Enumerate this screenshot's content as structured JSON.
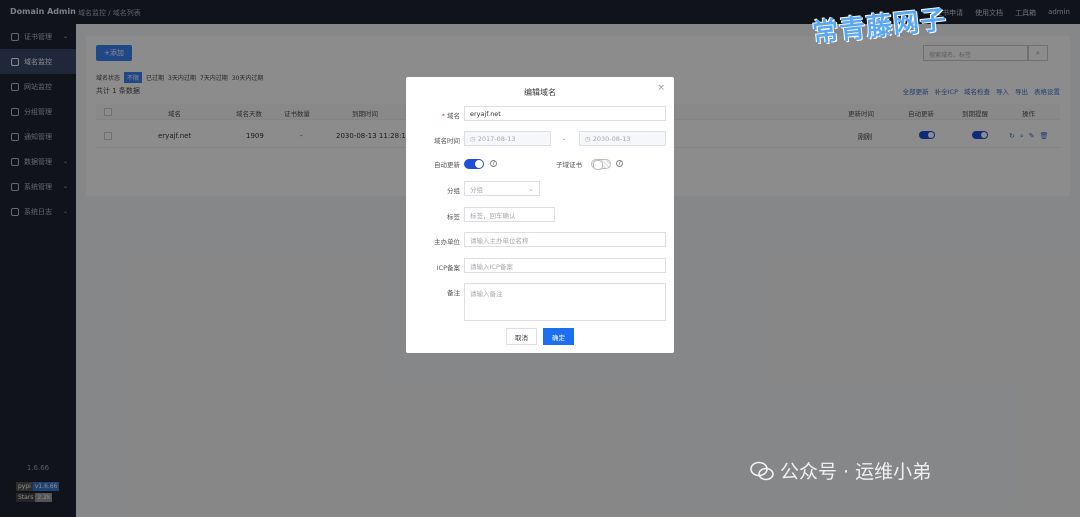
{
  "header": {
    "brand": "Domain Admin",
    "breadcrumb": "域名监控 / 域名列表",
    "links": [
      "证书申请",
      "使用文档",
      "工具箱",
      "admin"
    ]
  },
  "sidebar": {
    "items": [
      {
        "label": "证书管理",
        "icon": "certificate-icon",
        "has_children": true
      },
      {
        "label": "域名监控",
        "icon": "monitor-icon",
        "active": true
      },
      {
        "label": "网站监控",
        "icon": "website-icon"
      },
      {
        "label": "分组管理",
        "icon": "group-icon"
      },
      {
        "label": "通知管理",
        "icon": "notification-icon"
      },
      {
        "label": "数据管理",
        "icon": "data-icon",
        "has_children": true
      },
      {
        "label": "系统管理",
        "icon": "settings-icon",
        "has_children": true
      },
      {
        "label": "系统日志",
        "icon": "log-icon",
        "has_children": true
      }
    ],
    "version": "1.6.66",
    "badge_pypi_left": "pypi",
    "badge_pypi_right": "v1.6.66",
    "badge_stars_left": "Stars",
    "badge_stars_right": "2.2k"
  },
  "main": {
    "add_label": "+添加",
    "search_placeholder": "搜索域名、标签",
    "filter_label": "域名状态",
    "filters": [
      "不限",
      "已过期",
      "3天内过期",
      "7天内过期",
      "30天内过期"
    ],
    "total": "共计 1 条数据",
    "toolbar": [
      "全部更新",
      "补全ICP",
      "域名检查",
      "导入",
      "导出",
      "表格设置"
    ],
    "columns": [
      "域名",
      "域名天数",
      "证书数量",
      "到期时间",
      "更新时间",
      "自动更新",
      "到期提醒",
      "操作"
    ],
    "rows": [
      {
        "domain": "eryajf.net",
        "days": "1909",
        "certs": "-",
        "expire": "2030-08-13 11:28:15",
        "updated": "刚刚"
      }
    ]
  },
  "modal": {
    "title": "编辑域名",
    "domain_label": "域名",
    "domain_value": "eryajf.net",
    "time_label": "域名时间",
    "start_date": "2017-08-13",
    "date_sep": "-",
    "end_date": "2030-08-13",
    "auto_update_label": "自动更新",
    "auto_update": true,
    "subdomain_cert_label": "子域证书",
    "subdomain_cert": false,
    "group_label": "分组",
    "group_placeholder": "分组",
    "tags_label": "标签",
    "tags_placeholder": "标签，回车确认",
    "sponsor_label": "主办单位",
    "sponsor_placeholder": "请输入主办单位名称",
    "icp_label": "ICP备案",
    "icp_placeholder": "请输入ICP备案",
    "remark_label": "备注",
    "remark_placeholder": "请输入备注",
    "cancel_label": "取消",
    "confirm_label": "确定"
  },
  "watermarks": {
    "top": "常青藤网子",
    "bottom": "公众号 · 运维小弟"
  },
  "colors": {
    "accent": "#1d6ff2",
    "sidebar_bg": "#1f2430",
    "toggle_on": "#1d4fd8"
  }
}
